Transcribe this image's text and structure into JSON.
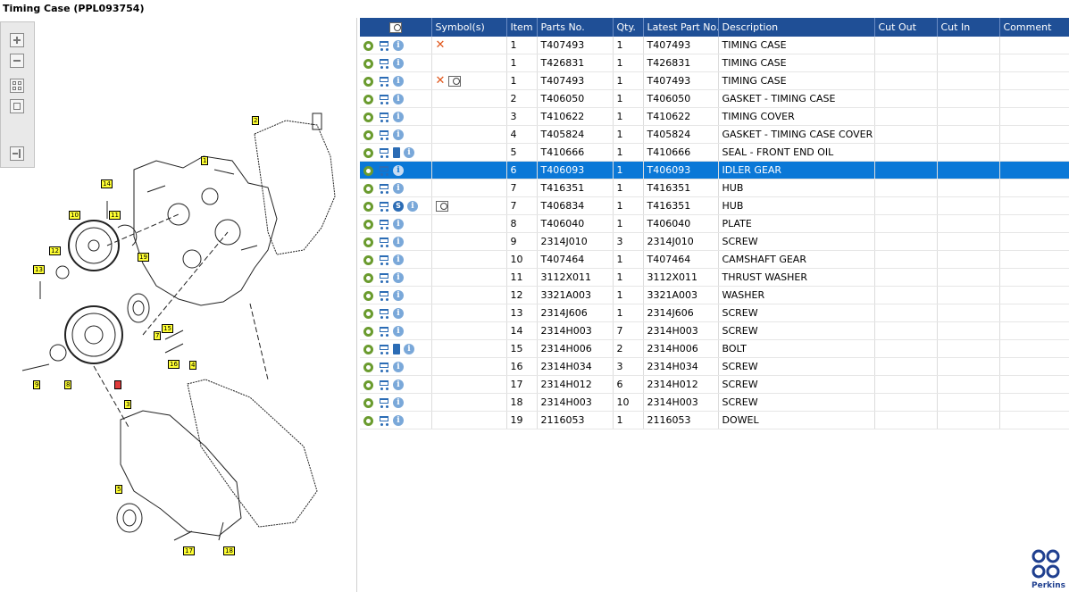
{
  "window": {
    "title": "Timing Case (PPL093754)"
  },
  "toolbar": {
    "zoom_in": "zoom-in",
    "zoom_out": "zoom-out",
    "fit": "fit-all",
    "actual": "actual-size",
    "panel": "toggle-panel"
  },
  "diagram": {
    "callouts": [
      "1",
      "2",
      "3",
      "4",
      "5",
      "6",
      "7",
      "8",
      "9",
      "10",
      "11",
      "12",
      "13",
      "14",
      "15",
      "16",
      "17",
      "18",
      "19"
    ]
  },
  "table": {
    "headers": [
      "",
      "Symbol(s)",
      "Item",
      "Parts No.",
      "Qty.",
      "Latest Part No.",
      "Description",
      "Cut Out",
      "Cut In",
      "Comment"
    ],
    "rows": [
      {
        "item": "1",
        "part": "T407493",
        "qty": "1",
        "latest": "T407493",
        "desc": "TIMING CASE"
      },
      {
        "item": "1",
        "part": "T426831",
        "qty": "1",
        "latest": "T426831",
        "desc": "TIMING CASE"
      },
      {
        "item": "1",
        "part": "T407493",
        "qty": "1",
        "latest": "T407493",
        "desc": "TIMING CASE"
      },
      {
        "item": "2",
        "part": "T406050",
        "qty": "1",
        "latest": "T406050",
        "desc": "GASKET - TIMING CASE"
      },
      {
        "item": "3",
        "part": "T410622",
        "qty": "1",
        "latest": "T410622",
        "desc": "TIMING COVER"
      },
      {
        "item": "4",
        "part": "T405824",
        "qty": "1",
        "latest": "T405824",
        "desc": "GASKET - TIMING CASE COVER"
      },
      {
        "item": "5",
        "part": "T410666",
        "qty": "1",
        "latest": "T410666",
        "desc": "SEAL - FRONT END OIL"
      },
      {
        "item": "6",
        "part": "T406093",
        "qty": "1",
        "latest": "T406093",
        "desc": "IDLER GEAR"
      },
      {
        "item": "7",
        "part": "T416351",
        "qty": "1",
        "latest": "T416351",
        "desc": "HUB"
      },
      {
        "item": "7",
        "part": "T406834",
        "qty": "1",
        "latest": "T416351",
        "desc": "HUB"
      },
      {
        "item": "8",
        "part": "T406040",
        "qty": "1",
        "latest": "T406040",
        "desc": "PLATE"
      },
      {
        "item": "9",
        "part": "2314J010",
        "qty": "3",
        "latest": "2314J010",
        "desc": "SCREW"
      },
      {
        "item": "10",
        "part": "T407464",
        "qty": "1",
        "latest": "T407464",
        "desc": "CAMSHAFT GEAR"
      },
      {
        "item": "11",
        "part": "3112X011",
        "qty": "1",
        "latest": "3112X011",
        "desc": "THRUST WASHER"
      },
      {
        "item": "12",
        "part": "3321A003",
        "qty": "1",
        "latest": "3321A003",
        "desc": "WASHER"
      },
      {
        "item": "13",
        "part": "2314J606",
        "qty": "1",
        "latest": "2314J606",
        "desc": "SCREW"
      },
      {
        "item": "14",
        "part": "2314H003",
        "qty": "7",
        "latest": "2314H003",
        "desc": "SCREW"
      },
      {
        "item": "15",
        "part": "2314H006",
        "qty": "2",
        "latest": "2314H006",
        "desc": "BOLT"
      },
      {
        "item": "16",
        "part": "2314H034",
        "qty": "3",
        "latest": "2314H034",
        "desc": "SCREW"
      },
      {
        "item": "17",
        "part": "2314H012",
        "qty": "6",
        "latest": "2314H012",
        "desc": "SCREW"
      },
      {
        "item": "18",
        "part": "2314H003",
        "qty": "10",
        "latest": "2314H003",
        "desc": "SCREW"
      },
      {
        "item": "19",
        "part": "2116053",
        "qty": "1",
        "latest": "2116053",
        "desc": "DOWEL"
      }
    ]
  },
  "brand": {
    "name": "Perkins",
    "color": "#1f3f8f"
  },
  "colors": {
    "header_bg": "#1f4f96",
    "selected_row": "#0a78d7",
    "callout_bg": "#ffff33"
  }
}
